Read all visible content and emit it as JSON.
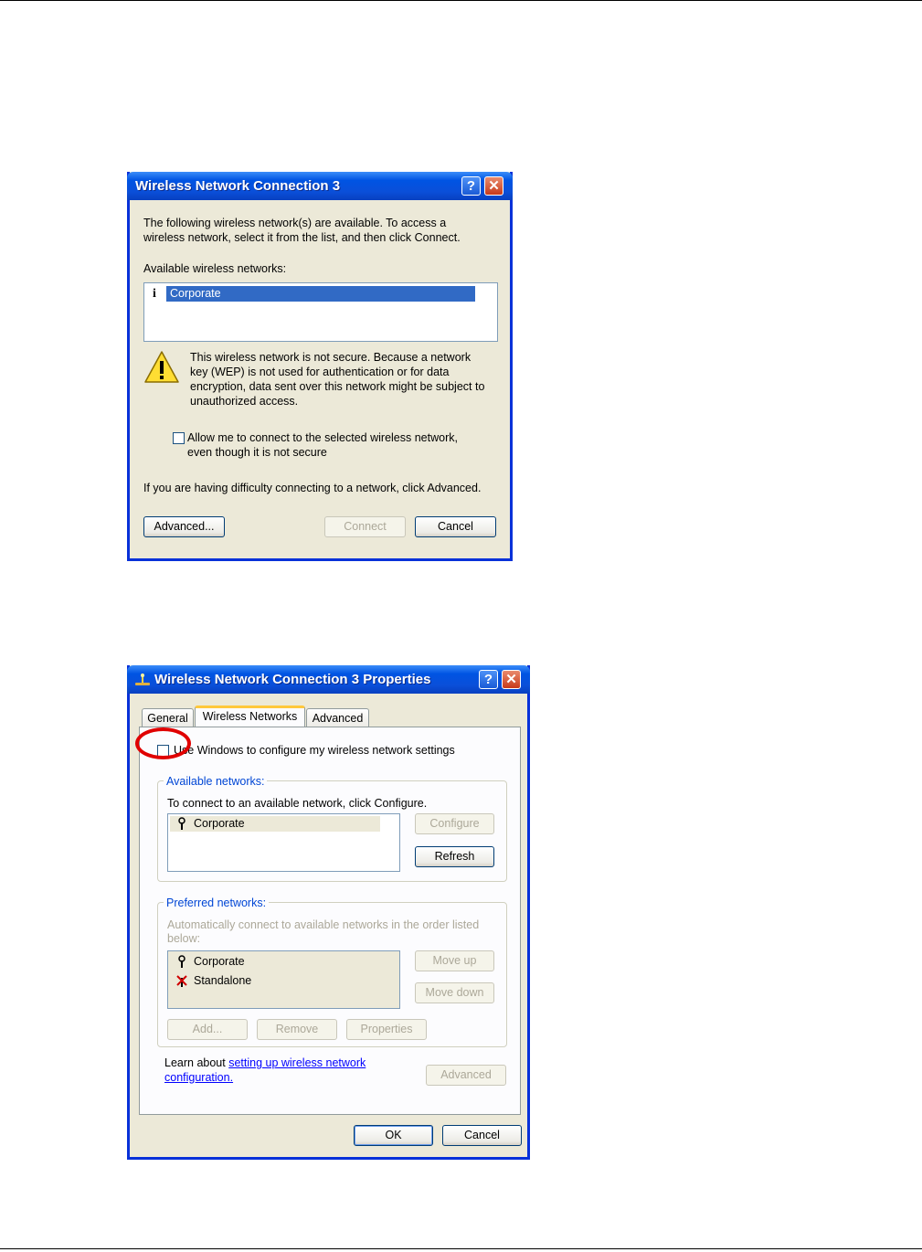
{
  "dialog1": {
    "title": "Wireless Network Connection 3",
    "help_btn": "?",
    "close_btn": "✕",
    "intro_line1": "The following wireless network(s) are available. To access a",
    "intro_line2": "wireless network, select it from the list, and then click Connect.",
    "available_label": "Available wireless networks:",
    "networks": [
      {
        "name": "Corporate",
        "selected": true
      }
    ],
    "warning_lines": [
      "This wireless network is not secure. Because a network",
      "key (WEP) is not used for authentication or for data",
      "encryption, data sent over this network might be subject to",
      "unauthorized access."
    ],
    "allow_line1": "Allow me to connect to the selected wireless network,",
    "allow_line2": "even though it is not secure",
    "difficulty_text": "If you are having difficulty connecting to a network, click Advanced.",
    "buttons": {
      "advanced": "Advanced...",
      "connect": "Connect",
      "cancel": "Cancel"
    }
  },
  "dialog2": {
    "title": "Wireless Network Connection 3 Properties",
    "help_btn": "?",
    "close_btn": "✕",
    "tabs": [
      "General",
      "Wireless Networks",
      "Advanced"
    ],
    "use_windows_label": "Use Windows to configure my wireless network settings",
    "available": {
      "legend": "Available networks:",
      "instructions": "To connect to an available network, click Configure.",
      "networks": [
        "Corporate"
      ],
      "configure_btn": "Configure",
      "refresh_btn": "Refresh"
    },
    "preferred": {
      "legend": "Preferred networks:",
      "instructions_line1": "Automatically connect to available networks in the order listed",
      "instructions_line2": "below:",
      "networks": [
        "Corporate",
        "Standalone"
      ],
      "move_up_btn": "Move up",
      "move_down_btn": "Move down",
      "add_btn": "Add...",
      "remove_btn": "Remove",
      "properties_btn": "Properties"
    },
    "learn_prefix": "Learn about ",
    "learn_link_line1": "setting up wireless network",
    "learn_link_line2": "configuration.",
    "advanced_btn": "Advanced",
    "ok_btn": "OK",
    "cancel_btn": "Cancel"
  }
}
